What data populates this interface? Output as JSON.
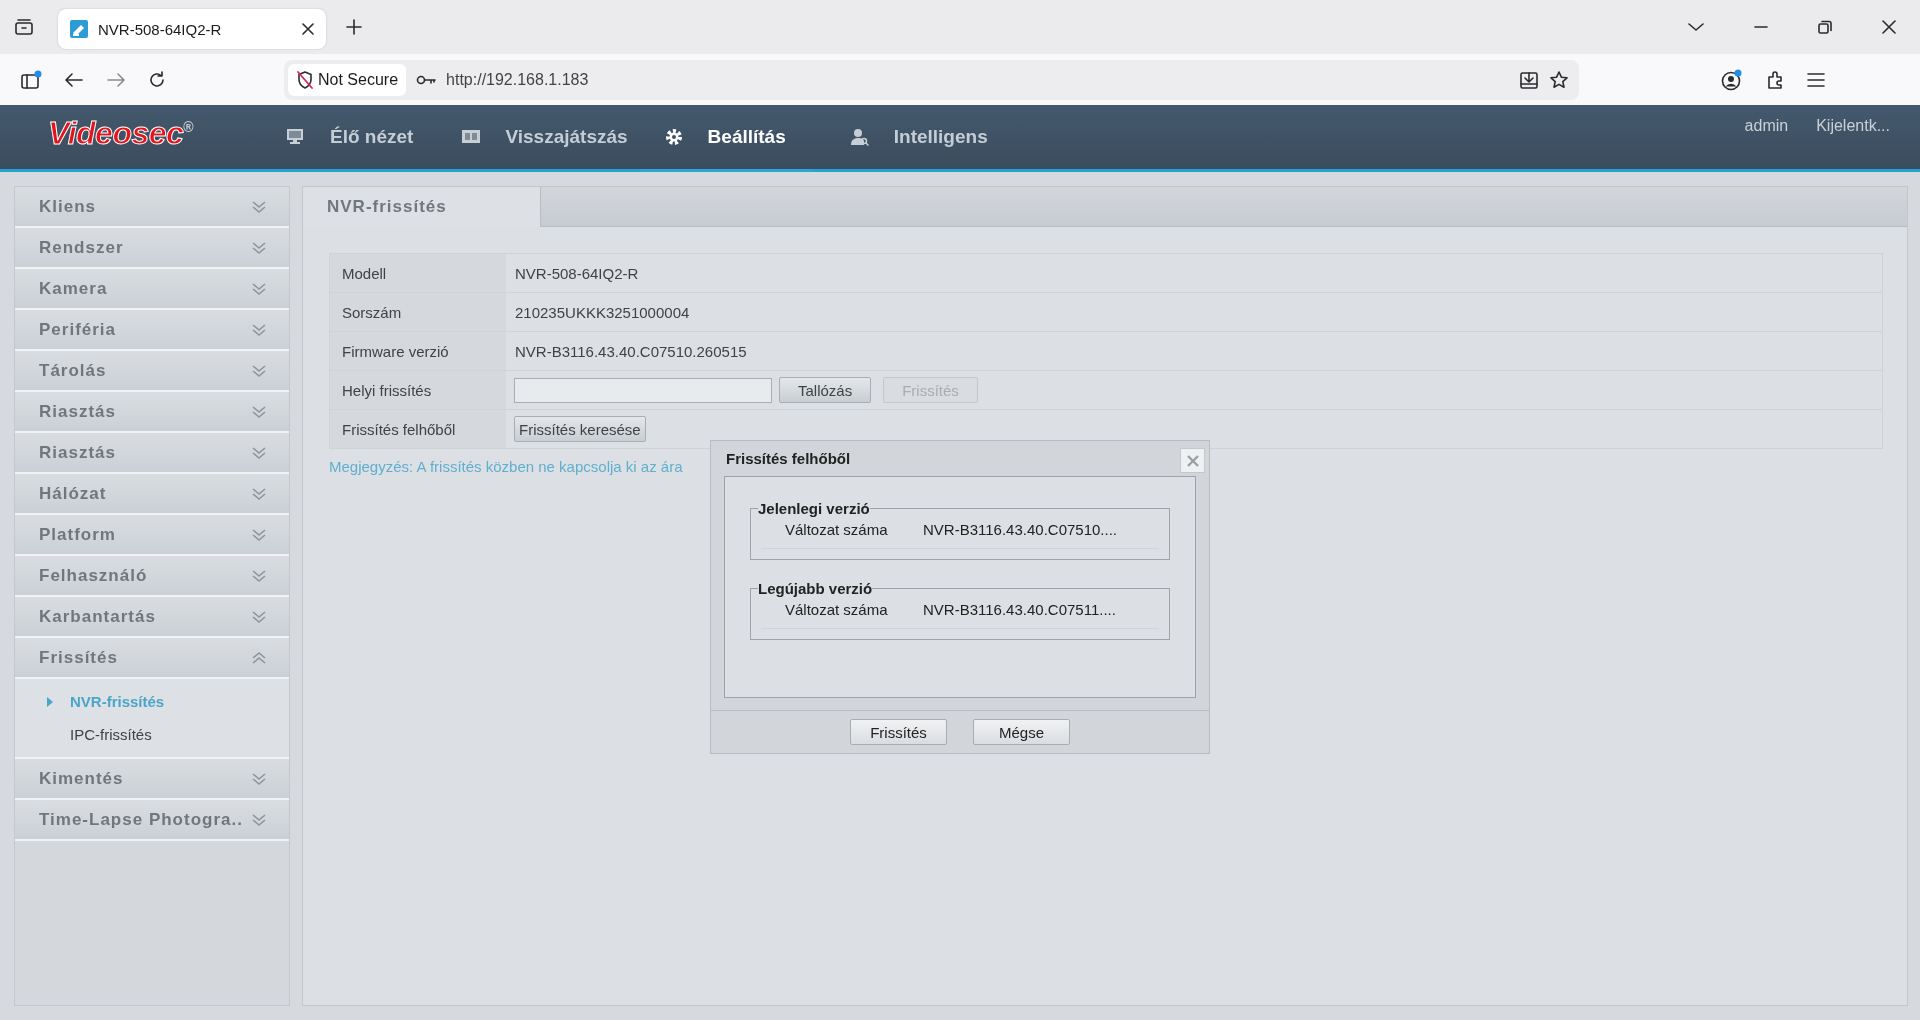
{
  "browser": {
    "tab_title": "NVR-508-64IQ2-R",
    "security": "Not Secure",
    "url": "http://192.168.1.183"
  },
  "header": {
    "logo": "Videosec$^{®}$",
    "nav": [
      {
        "label": "Élő nézet",
        "kind": "monitor",
        "selected": false
      },
      {
        "label": "Visszajátszás",
        "kind": "film",
        "selected": false
      },
      {
        "label": "Beállítás",
        "kind": "gear",
        "selected": true
      },
      {
        "label": "Intelligens",
        "kind": "person",
        "selected": false
      }
    ],
    "user": "admin",
    "logout": "Kijelentk..."
  },
  "sidebar": {
    "items": [
      {
        "label": "Kliens",
        "expanded": false
      },
      {
        "label": "Rendszer",
        "expanded": false
      },
      {
        "label": "Kamera",
        "expanded": false
      },
      {
        "label": "Periféria",
        "expanded": false
      },
      {
        "label": "Tárolás",
        "expanded": false
      },
      {
        "label": "Riasztás",
        "expanded": false
      },
      {
        "label": "Riasztás",
        "expanded": false
      },
      {
        "label": "Hálózat",
        "expanded": false
      },
      {
        "label": "Platform",
        "expanded": false
      },
      {
        "label": "Felhasználó",
        "expanded": false
      },
      {
        "label": "Karbantartás",
        "expanded": false
      },
      {
        "label": "Frissítés",
        "expanded": true,
        "children": [
          {
            "label": "NVR-frissítés",
            "selected": true
          },
          {
            "label": "IPC-frissítés",
            "selected": false
          }
        ]
      },
      {
        "label": "Kimentés",
        "expanded": false
      },
      {
        "label": "Time-Lapse Photogra..",
        "expanded": false
      }
    ]
  },
  "content": {
    "tabs": [
      {
        "label": "NVR-frissítés",
        "selected": true
      }
    ],
    "rows": [
      {
        "kind": "text",
        "label": "Modell",
        "value": "NVR-508-64IQ2-R"
      },
      {
        "kind": "text",
        "label": "Sorszám",
        "value": "210235UKKK3251000004"
      },
      {
        "kind": "text",
        "label": "Firmware verzió",
        "value": "NVR-B3116.43.40.C07510.260515"
      },
      {
        "kind": "upload",
        "label": "Helyi frissítés",
        "buttons": [
          {
            "label": "Tallózás",
            "disabled": false
          },
          {
            "label": "Frissítés",
            "disabled": true
          }
        ]
      },
      {
        "kind": "action",
        "label": "Frissítés felhőből",
        "buttons": [
          {
            "label": "Frissítés keresése",
            "disabled": false
          }
        ]
      }
    ],
    "note": "Megjegyzés: A frissítés közben ne kapcsolja ki az ára"
  },
  "dialog": {
    "title": "Frissítés felhőből",
    "groups": [
      {
        "legend": "Jelenlegi verzió",
        "label": "Változat száma",
        "value": "NVR-B3116.43.40.C07510...."
      },
      {
        "legend": "Legújabb verzió",
        "label": "Változat száma",
        "value": "NVR-B3116.43.40.C07511...."
      }
    ],
    "buttons": [
      {
        "label": "Frissítés"
      },
      {
        "label": "Mégse"
      }
    ]
  }
}
